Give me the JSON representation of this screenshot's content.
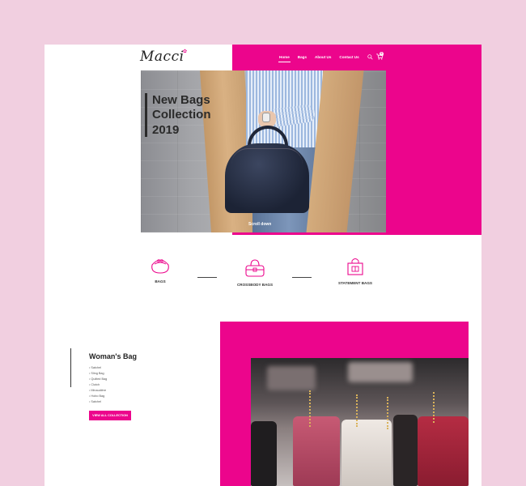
{
  "brand": {
    "logo_text": "Macci"
  },
  "nav": {
    "items": [
      {
        "label": "Home",
        "active": true
      },
      {
        "label": "Bags",
        "active": false
      },
      {
        "label": "About Us",
        "active": false
      },
      {
        "label": "Contact Us",
        "active": false
      }
    ],
    "search_icon": "search-icon",
    "cart_icon": "cart-icon",
    "cart_count": "0"
  },
  "hero": {
    "title_line1": "New Bags",
    "title_line2": "Collection",
    "title_line3": "2019",
    "scroll_label": "Scroll down"
  },
  "categories": [
    {
      "label": "BAGS",
      "icon": "purse-icon"
    },
    {
      "label": "CROSSBODY BAGS",
      "icon": "crossbody-bag-icon"
    },
    {
      "label": "STATEMENT BAGS",
      "icon": "shopping-bag-icon"
    }
  ],
  "section2": {
    "title": "Woman's Bag",
    "items": [
      "Satchel",
      "Sling Bag",
      "Quilted Bag",
      "Clutch",
      "Minaudière",
      "Hobo Bag",
      "Satchel"
    ],
    "button_label": "VIEW ALL COLLECTION"
  },
  "colors": {
    "accent": "#ec058c",
    "background": "#f1cfe0",
    "text": "#2b2b2b"
  }
}
